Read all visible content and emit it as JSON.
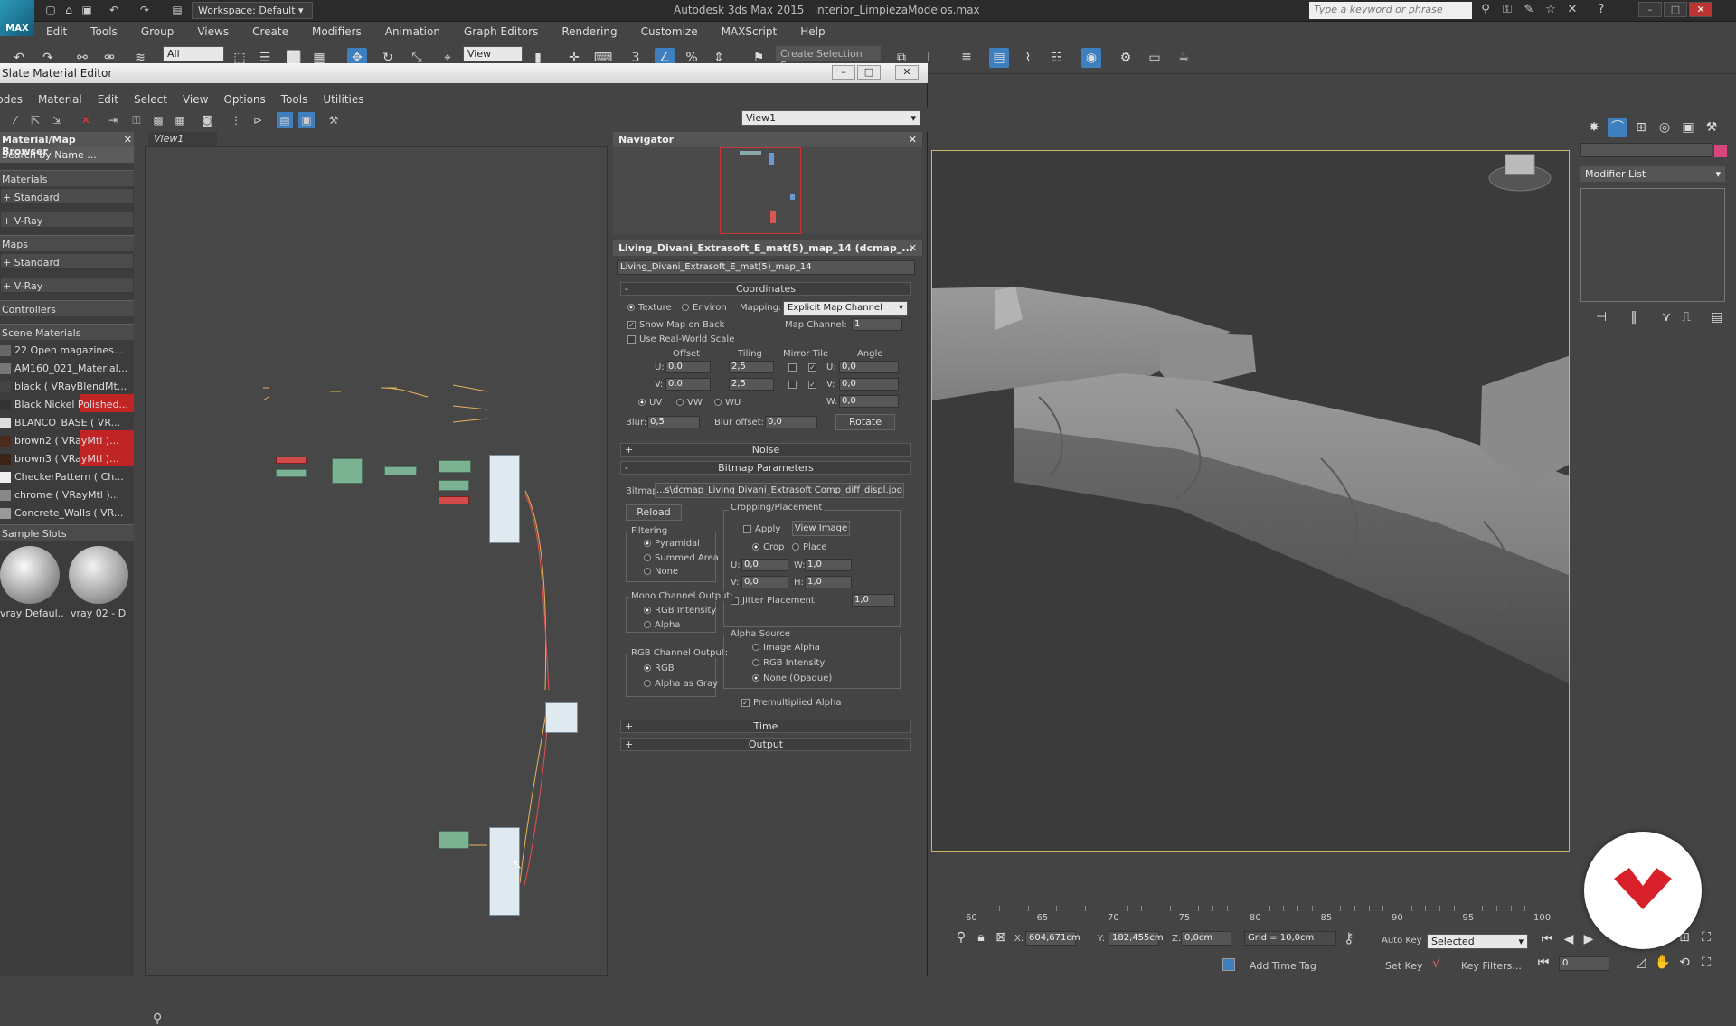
{
  "app": {
    "title": "Autodesk 3ds Max 2015",
    "file": "interior_LimpiezaModelos.max",
    "workspace": "Workspace: Default",
    "search_placeholder": "Type a keyword or phrase",
    "logo": "MAX"
  },
  "menubar": [
    "Edit",
    "Tools",
    "Group",
    "Views",
    "Create",
    "Modifiers",
    "Animation",
    "Graph Editors",
    "Rendering",
    "Customize",
    "MAXScript",
    "Help"
  ],
  "toolbar": {
    "filter": "All",
    "ref_coord": "View",
    "selection_set": "Create Selection Se"
  },
  "slate": {
    "title": "Slate Material Editor",
    "menu": [
      "Modes",
      "Material",
      "Edit",
      "Select",
      "View",
      "Options",
      "Tools",
      "Utilities"
    ],
    "view_dropdown": "View1",
    "view_tab": "View1"
  },
  "browser": {
    "title": "Material/Map Browser",
    "search": "Search by Name ...",
    "materials_label": "Materials",
    "materials_items": [
      "+ Standard",
      "+ V-Ray"
    ],
    "maps_label": "Maps",
    "maps_items": [
      "+ Standard",
      "+ V-Ray"
    ],
    "controllers_label": "Controllers",
    "scene_label": "Scene Materials",
    "scene_items": [
      {
        "label": "22 Open magazines...",
        "swatch": "#666"
      },
      {
        "label": "AM160_021_Material...",
        "swatch": "#777"
      },
      {
        "label": "black ( VRayBlendMt...",
        "swatch": "#444"
      },
      {
        "label": "Black Nickel Polished...",
        "swatch": "#333",
        "red": true
      },
      {
        "label": "BLANCO_BASE ( VR...",
        "swatch": "#ddd"
      },
      {
        "label": "brown2 ( VRayMtl )...",
        "swatch": "#4a2b1c",
        "red": true
      },
      {
        "label": "brown3 ( VRayMtl )...",
        "swatch": "#3a2416",
        "red": true
      },
      {
        "label": "CheckerPattern ( Ch...",
        "swatch": "#eee"
      },
      {
        "label": "chrome ( VRayMtl )...",
        "swatch": "#888"
      },
      {
        "label": "Concrete_Walls ( VR...",
        "swatch": "#999"
      }
    ],
    "sample_label": "Sample Slots",
    "samples": [
      "vray Defaul...",
      "vray 02 - D"
    ]
  },
  "navigator": {
    "title": "Navigator"
  },
  "params": {
    "header": "Living_Divani_Extrasoft_E_mat(5)_map_14 (dcmap_...",
    "name": "Living_Divani_Extrasoft_E_mat(5)_map_14",
    "coordinates": {
      "title": "Coordinates",
      "texture": "Texture",
      "environ": "Environ",
      "mapping_label": "Mapping:",
      "mapping": "Explicit Map Channel",
      "show_map_back": "Show Map on Back",
      "map_channel_label": "Map Channel:",
      "map_channel": "1",
      "real_world": "Use Real-World Scale",
      "offset": "Offset",
      "tiling": "Tiling",
      "mirror_tile": "Mirror Tile",
      "angle": "Angle",
      "u": "U:",
      "v": "V:",
      "w": "W:",
      "offset_u": "0,0",
      "offset_v": "0,0",
      "tiling_u": "2,5",
      "tiling_v": "2,5",
      "angle_u": "0,0",
      "angle_v": "0,0",
      "angle_w": "0,0",
      "uv": "UV",
      "vw": "VW",
      "wu": "WU",
      "blur_label": "Blur:",
      "blur": "0,5",
      "blur_offset_label": "Blur offset:",
      "blur_offset": "0,0",
      "rotate": "Rotate"
    },
    "noise": "Noise",
    "bitmap": {
      "title": "Bitmap Parameters",
      "bitmap_label": "Bitmap:",
      "bitmap_path": "...s\\dcmap_Living Divani_Extrasoft Comp_diff_displ.jpg",
      "reload": "Reload",
      "crop_title": "Cropping/Placement",
      "apply": "Apply",
      "view_image": "View Image",
      "crop": "Crop",
      "place": "Place",
      "u": "U:",
      "v": "V:",
      "w": "W:",
      "h": "H:",
      "crop_u": "0,0",
      "crop_v": "0,0",
      "crop_w": "1,0",
      "crop_h": "1,0",
      "jitter": "Jitter Placement:",
      "jitter_val": "1,0",
      "filtering": "Filtering",
      "pyramidal": "Pyramidal",
      "summed": "Summed Area",
      "none": "None",
      "mono": "Mono Channel Output:",
      "rgb_intensity": "RGB Intensity",
      "alpha": "Alpha",
      "rgb_channel": "RGB Channel Output:",
      "rgb": "RGB",
      "alpha_gray": "Alpha as Gray",
      "alpha_source": "Alpha Source",
      "image_alpha": "Image Alpha",
      "rgb_int2": "RGB Intensity",
      "none_opaque": "None (Opaque)",
      "premult": "Premultiplied Alpha"
    },
    "time": "Time",
    "output": "Output"
  },
  "command_panel": {
    "modifier_list": "Modifier List"
  },
  "timeline": {
    "ticks": [
      "60",
      "65",
      "70",
      "75",
      "80",
      "85",
      "90",
      "95",
      "100"
    ]
  },
  "status": {
    "x_label": "X:",
    "x": "604,671cm",
    "y_label": "Y:",
    "y": "182,455cm",
    "z_label": "Z:",
    "z": "0,0cm",
    "grid": "Grid = 10,0cm",
    "auto_key": "Auto Key",
    "selected": "Selected",
    "set_key": "Set Key",
    "key_filters": "Key Filters...",
    "add_time_tag": "Add Time Tag",
    "frame": "0"
  }
}
